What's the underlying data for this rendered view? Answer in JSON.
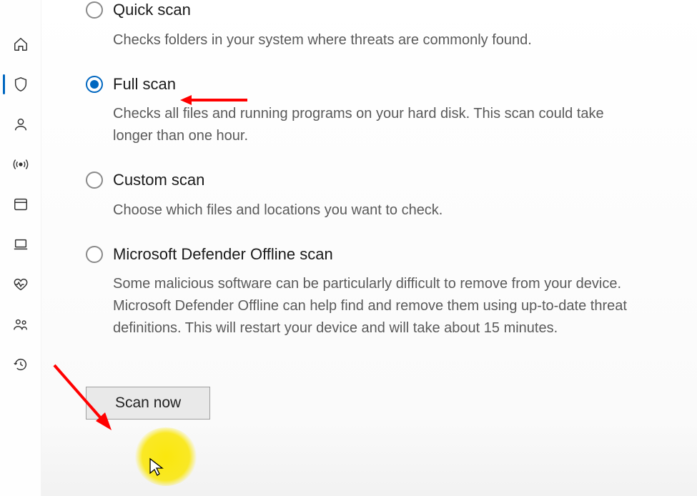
{
  "sidebar": {
    "items": [
      {
        "name": "home"
      },
      {
        "name": "shield",
        "active": true
      },
      {
        "name": "account"
      },
      {
        "name": "firewall"
      },
      {
        "name": "app-browser"
      },
      {
        "name": "device-performance"
      },
      {
        "name": "device-health"
      },
      {
        "name": "family"
      },
      {
        "name": "history"
      }
    ]
  },
  "options": [
    {
      "key": "quick",
      "title": "Quick scan",
      "desc": "Checks folders in your system where threats are commonly found.",
      "selected": false
    },
    {
      "key": "full",
      "title": "Full scan",
      "desc": "Checks all files and running programs on your hard disk. This scan could take longer than one hour.",
      "selected": true
    },
    {
      "key": "custom",
      "title": "Custom scan",
      "desc": "Choose which files and locations you want to check.",
      "selected": false
    },
    {
      "key": "offline",
      "title": "Microsoft Defender Offline scan",
      "desc": "Some malicious software can be particularly difficult to remove from your device. Microsoft Defender Offline can help find and remove them using up-to-date threat definitions. This will restart your device and will take about 15 minutes.",
      "selected": false
    }
  ],
  "scan_button": "Scan now"
}
